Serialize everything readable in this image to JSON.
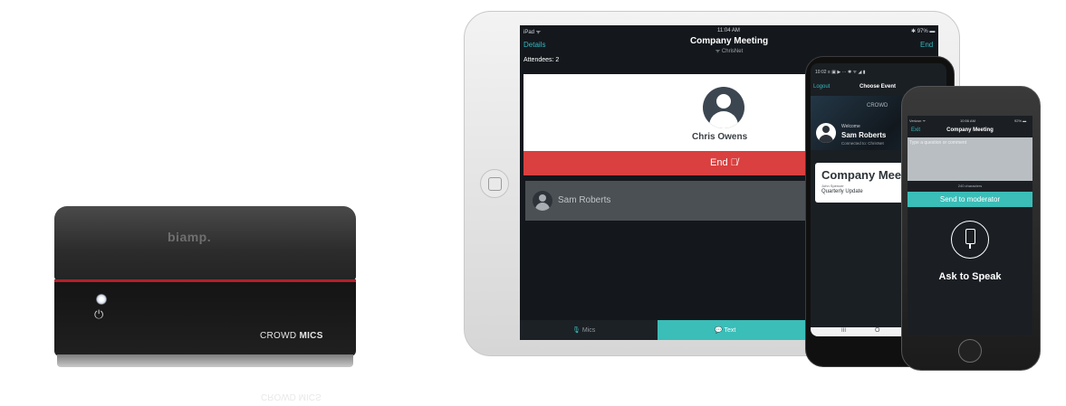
{
  "box": {
    "top_logo": "biamp.",
    "power_symbol": "⏻",
    "brand_light": "CROWD ",
    "brand_bold": "MICS",
    "reflection": "CROWD MICS"
  },
  "ipad": {
    "status_left": "iPad ᯤ",
    "status_time": "11:04 AM",
    "status_right": "✱ 97% ▬",
    "nav_left": "Details",
    "title": "Company Meeting",
    "subtitle": "ᯤ ChrisNet",
    "nav_right": "End",
    "attendees": "Attendees: 2",
    "speaker_name": "Chris Owens",
    "end_label": "End 🎙̸",
    "queue_name": "Sam Roberts",
    "tab_mics": "Mics",
    "tab_mics_icon": "🎙",
    "tab_text": "💬 Text"
  },
  "android": {
    "status": "10:02 ≡ ▣ ▶ ···        ✱ ᯤ ◢ ▮",
    "nav_left": "Logout",
    "title": "Choose Event",
    "hero_brand": "CROWD",
    "welcome": "Welcome",
    "user": "Sam Roberts",
    "connected": "Connected to: ChrisNet",
    "event_title": "Company Meeting",
    "event_host": "John Spencer",
    "event_name": "Quarterly Update",
    "nav_recent": "III",
    "nav_home": "O"
  },
  "iphone": {
    "status_left": "Verizon ᯤ",
    "status_time": "10:56 AM",
    "status_right": "92% ▬",
    "nav_left": "Exit",
    "title": "Company Meeting",
    "placeholder": "Type a question or comment",
    "chars": "240 characters",
    "send_label": "Send to moderator",
    "ask_label": "Ask to Speak"
  },
  "colors": {
    "accent": "#3bbdb8",
    "end_red": "#d9403f",
    "box_stripe": "#b2202b"
  }
}
